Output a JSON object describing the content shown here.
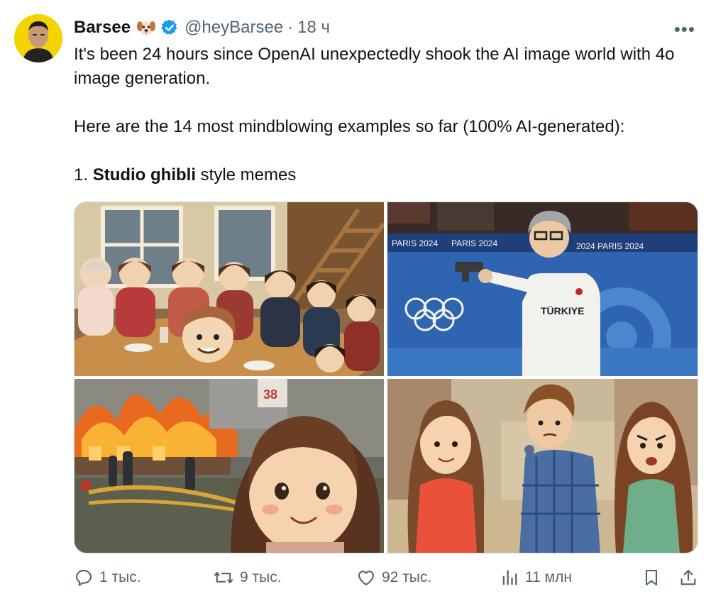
{
  "post": {
    "author": {
      "display_name": "Barsee",
      "emoji": "🐶",
      "handle": "@heyBarsee",
      "separator": "·",
      "time": "18 ч"
    },
    "more_icon": "more-horizontal-icon",
    "text": {
      "line1": "It's been 24 hours since OpenAI unexpectedly shook the AI image world with 4o image generation.",
      "line2": "Here are the 14 most mindblowing examples so far (100% AI-generated):",
      "line3_prefix": "1. ",
      "line3_bold": "Studio ghibli",
      "line3_suffix": " style memes"
    },
    "media": {
      "image2": {
        "banner_left": "PARIS 2024",
        "banner_mid": "PARIS 2024",
        "banner_right": "2024 PARIS 2024",
        "shirt_text": "TÜRKIYE"
      },
      "image3": {
        "sign_text": "38"
      }
    },
    "actions": {
      "reply": {
        "icon": "reply-icon",
        "count": "1 тыс."
      },
      "retweet": {
        "icon": "retweet-icon",
        "count": "9 тыс."
      },
      "like": {
        "icon": "heart-icon",
        "count": "92 тыс."
      },
      "views": {
        "icon": "views-icon",
        "count": "11 млн"
      },
      "bookmark": {
        "icon": "bookmark-icon"
      },
      "share": {
        "icon": "share-icon"
      }
    },
    "colors": {
      "text": "#0f1419",
      "secondary": "#536471",
      "verified": "#1d9bf0",
      "avatar_bg": "#f3d400"
    }
  }
}
